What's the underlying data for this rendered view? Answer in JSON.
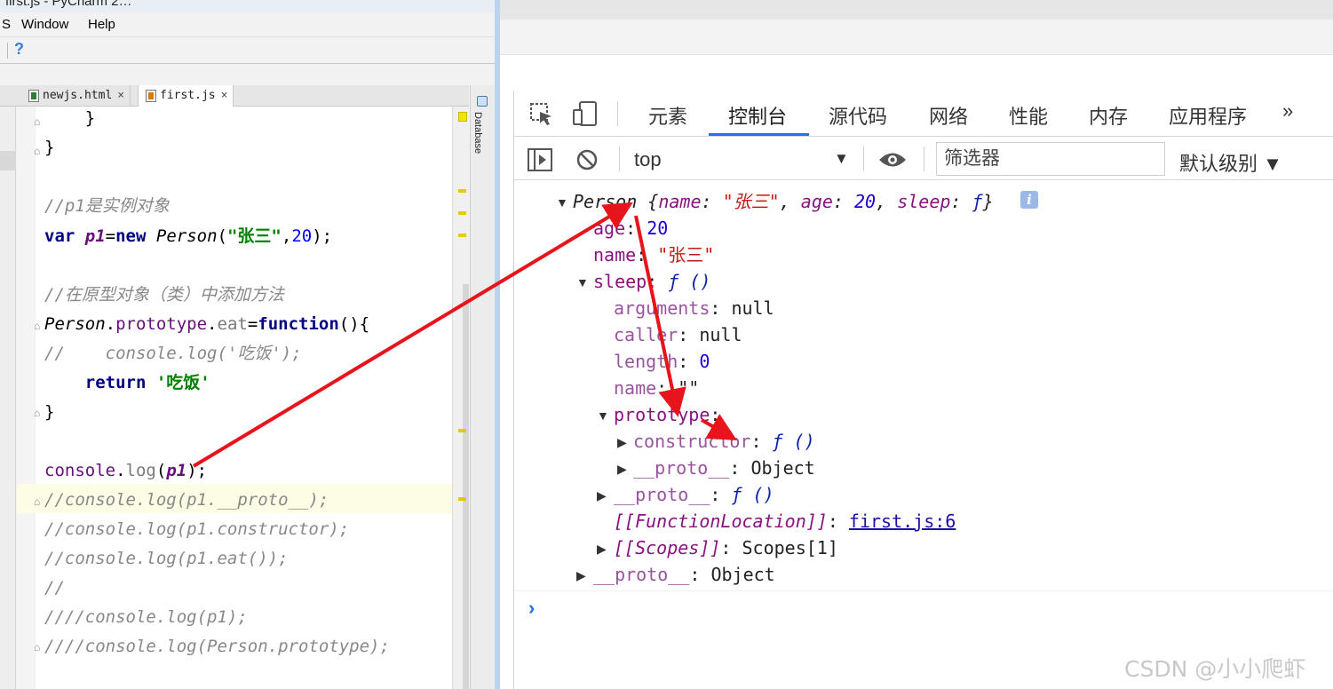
{
  "ide": {
    "title_fragment": "first.js - PyCharm 2…",
    "menu": [
      "S",
      "Window",
      "Help"
    ],
    "help_icon": "?",
    "tabs": [
      {
        "label": "newjs.html",
        "close": "×"
      },
      {
        "label": "first.js",
        "close": "×"
      }
    ],
    "side_panel": "Database",
    "code_lines": {
      "l1": "    }",
      "l2": "}",
      "c1": "//p1是实例对象",
      "v_kw": "var ",
      "v_name": "p1",
      "v_eq": "=",
      "v_new": "new ",
      "v_cls": "Person",
      "v_open": "(",
      "v_str": "\"张三\"",
      "v_comma": ",",
      "v_num": "20",
      "v_close": ");",
      "c2": "//在原型对象（类）中添加方法",
      "p_cls": "Person",
      "p_dot": ".",
      "p_proto": "prototype",
      "p_dot2": ".",
      "p_eat": "eat",
      "p_eq": "=",
      "p_fn": "function",
      "p_rest": "(){",
      "c3": "//    console.log('吃饭');",
      "r_kw": "    return ",
      "r_str": "'吃饭'",
      "close": "}",
      "log_obj": "console",
      "log_dot": ".",
      "log_m": "log",
      "log_open": "(",
      "log_arg": "p1",
      "log_close": ");",
      "c4": "//console.log(p1.__proto__);",
      "c5": "//console.log(p1.constructor);",
      "c6": "//console.log(p1.eat());",
      "c7": "//",
      "c8": "////console.log(p1);",
      "c9": "////console.log(Person.prototype);"
    }
  },
  "devtools": {
    "tabs": [
      "元素",
      "控制台",
      "源代码",
      "网络",
      "性能",
      "内存",
      "应用程序"
    ],
    "more": "»",
    "active_tab": "控制台",
    "context": "top",
    "context_arrow": "▼",
    "filter_placeholder": "筛选器",
    "level": "默认级别 ▼",
    "console": {
      "summary_cls": "Person",
      "summary_body_1": " {",
      "summary_k1": "name",
      "summary_sep1": ": ",
      "summary_v1": "\"张三\"",
      "summary_c1": ", ",
      "summary_k2": "age",
      "summary_sep2": ": ",
      "summary_v2": "20",
      "summary_c2": ", ",
      "summary_k3": "sleep",
      "summary_sep3": ": ",
      "summary_v3": "ƒ",
      "summary_end": "}",
      "info": "i",
      "age_k": "age",
      "age_v": "20",
      "name_k": "name",
      "name_v": "\"张三\"",
      "sleep_k": "sleep",
      "sleep_v": "ƒ ()",
      "arguments_k": "arguments",
      "arguments_v": "null",
      "caller_k": "caller",
      "caller_v": "null",
      "length_k": "length",
      "length_v": "0",
      "fname_k": "name",
      "fname_v": "\"\"",
      "prototype_k": "prototype",
      "constructor_k": "constructor",
      "constructor_v": "ƒ ()",
      "pproto_k": "__proto__",
      "pproto_v": "Object",
      "sproto_k": "__proto__",
      "sproto_v": "ƒ ()",
      "floc_k": "[[FunctionLocation]]",
      "floc_v": "first.js:6",
      "scopes_k": "[[Scopes]]",
      "scopes_v": "Scopes[1]",
      "oproto_k": "__proto__",
      "oproto_v": "Object",
      "colon": ": ",
      "prompt": "›"
    }
  },
  "watermark": "CSDN @小小爬虾",
  "colors": {
    "arrow": "#e8141b",
    "active_tab_underline": "#1a73e8",
    "key": "#881280",
    "string": "#c41a16",
    "number": "#1c00cf"
  }
}
